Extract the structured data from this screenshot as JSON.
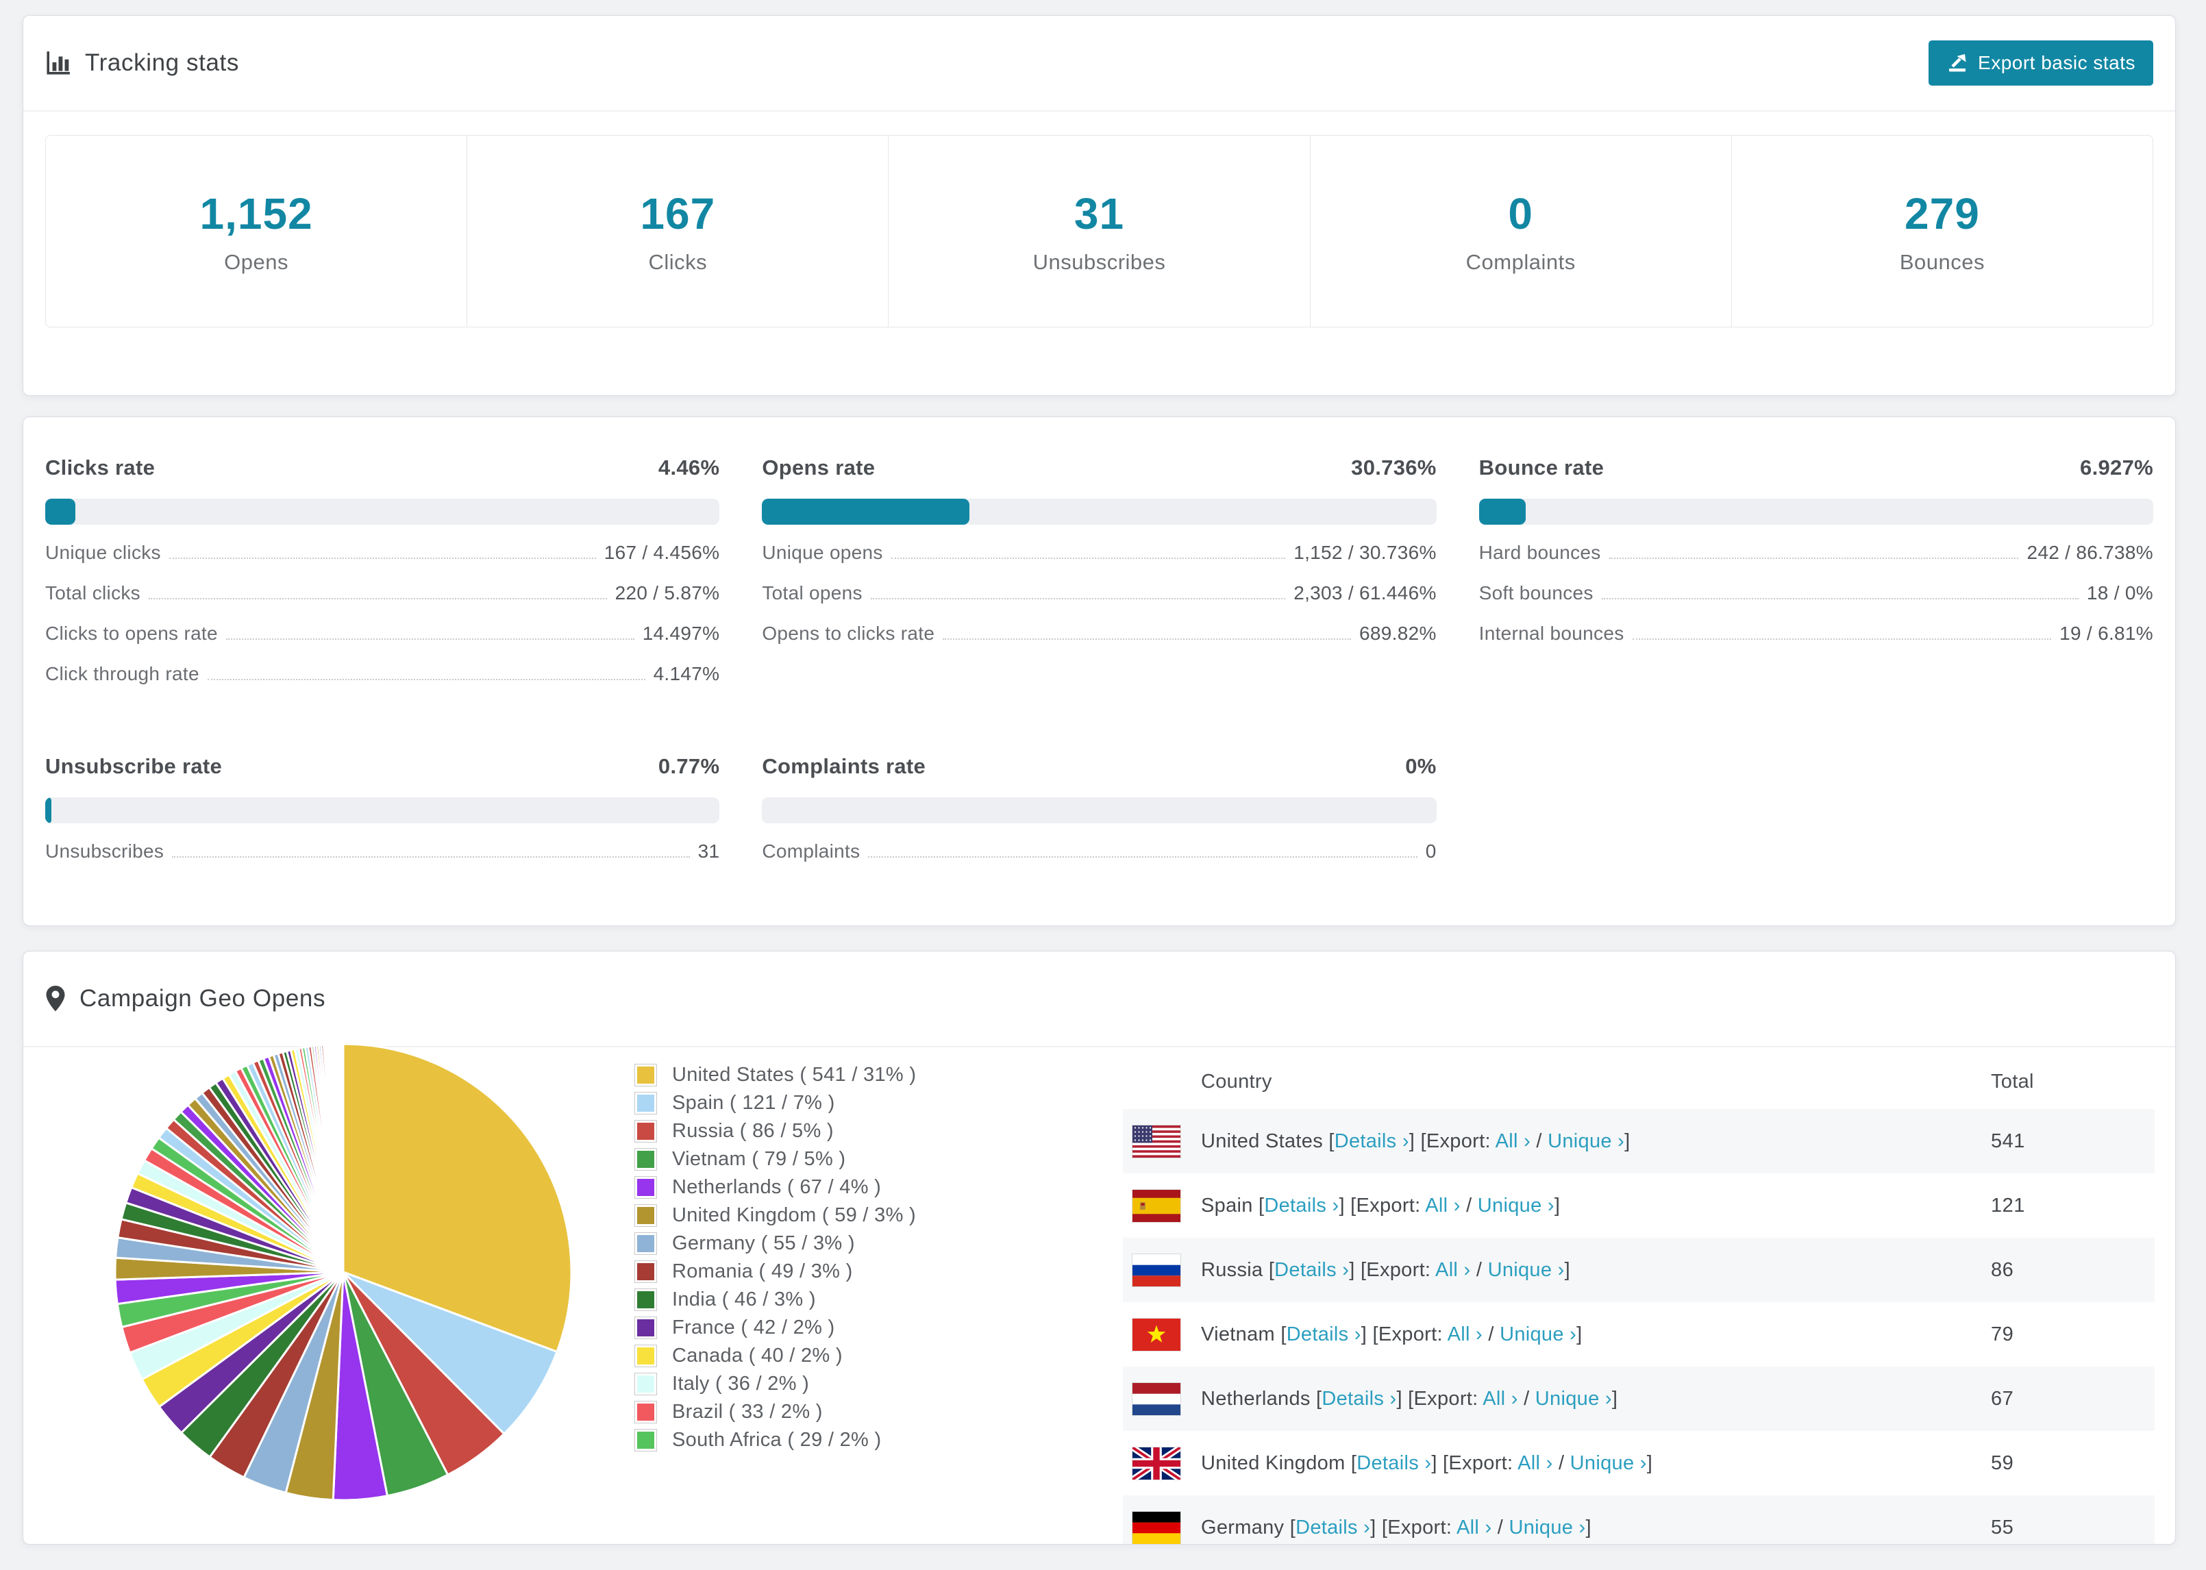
{
  "theme": {
    "accent_color": "#1287a3",
    "link_color": "#2b9ec0",
    "page_background": "#f1f2f4"
  },
  "tracking_card": {
    "title": "Tracking stats",
    "title_icon": "bar-chart-icon",
    "export_button": {
      "label": "Export basic stats",
      "icon": "export-icon"
    },
    "summary": [
      {
        "value": "1,152",
        "label": "Opens"
      },
      {
        "value": "167",
        "label": "Clicks"
      },
      {
        "value": "31",
        "label": "Unsubscribes"
      },
      {
        "value": "0",
        "label": "Complaints"
      },
      {
        "value": "279",
        "label": "Bounces"
      }
    ]
  },
  "rates_card": {
    "blocks": [
      {
        "id": "clicks",
        "title": "Clicks rate",
        "value": "4.46%",
        "percent": 4.46,
        "rows": [
          {
            "label": "Unique clicks",
            "value": "167 / 4.456%"
          },
          {
            "label": "Total clicks",
            "value": "220 / 5.87%"
          },
          {
            "label": "Clicks to opens rate",
            "value": "14.497%"
          },
          {
            "label": "Click through rate",
            "value": "4.147%"
          }
        ]
      },
      {
        "id": "opens",
        "title": "Opens rate",
        "value": "30.736%",
        "percent": 30.736,
        "rows": [
          {
            "label": "Unique opens",
            "value": "1,152 / 30.736%"
          },
          {
            "label": "Total opens",
            "value": "2,303 / 61.446%"
          },
          {
            "label": "Opens to clicks rate",
            "value": "689.82%"
          }
        ]
      },
      {
        "id": "bounce",
        "title": "Bounce rate",
        "value": "6.927%",
        "percent": 6.927,
        "rows": [
          {
            "label": "Hard bounces",
            "value": "242 / 86.738%"
          },
          {
            "label": "Soft bounces",
            "value": "18 / 0%"
          },
          {
            "label": "Internal bounces",
            "value": "19 / 6.81%"
          }
        ]
      },
      {
        "id": "unsubscribe",
        "title": "Unsubscribe rate",
        "value": "0.77%",
        "percent": 0.77,
        "rows": [
          {
            "label": "Unsubscribes",
            "value": "31"
          }
        ]
      },
      {
        "id": "complaints",
        "title": "Complaints rate",
        "value": "0%",
        "percent": 0,
        "rows": [
          {
            "label": "Complaints",
            "value": "0"
          }
        ]
      }
    ]
  },
  "geo_card": {
    "title": "Campaign Geo Opens",
    "title_icon": "map-pin-icon",
    "table": {
      "headers": [
        "Country",
        "Total"
      ],
      "link_labels": {
        "details": "Details ›",
        "all": "All ›",
        "unique": "Unique ›",
        "details_prefix": "[",
        "details_suffix": "] ",
        "export_prefix": "[Export: ",
        "separator": " / ",
        "export_suffix": "]"
      },
      "rows": [
        {
          "country": "United States",
          "flag": "us",
          "total": "541"
        },
        {
          "country": "Spain",
          "flag": "es",
          "total": "121"
        },
        {
          "country": "Russia",
          "flag": "ru",
          "total": "86"
        },
        {
          "country": "Vietnam",
          "flag": "vn",
          "total": "79"
        },
        {
          "country": "Netherlands",
          "flag": "nl",
          "total": "67"
        },
        {
          "country": "United Kingdom",
          "flag": "gb",
          "total": "59"
        },
        {
          "country": "Germany",
          "flag": "de",
          "total": "55"
        }
      ]
    }
  },
  "chart_data": {
    "type": "pie",
    "title": "Campaign Geo Opens",
    "legend_position": "right",
    "start_angle_deg": -90,
    "direction": "clockwise",
    "slices": [
      {
        "label": "United States",
        "value": 541,
        "percent": "31%",
        "color": "#e8c23e"
      },
      {
        "label": "Spain",
        "value": 121,
        "percent": "7%",
        "color": "#abd7f5"
      },
      {
        "label": "Russia",
        "value": 86,
        "percent": "5%",
        "color": "#c94a43"
      },
      {
        "label": "Vietnam",
        "value": 79,
        "percent": "5%",
        "color": "#41a048"
      },
      {
        "label": "Netherlands",
        "value": 67,
        "percent": "4%",
        "color": "#9634ee"
      },
      {
        "label": "United Kingdom",
        "value": 59,
        "percent": "3%",
        "color": "#b3952f"
      },
      {
        "label": "Germany",
        "value": 55,
        "percent": "3%",
        "color": "#8fb3d6"
      },
      {
        "label": "Romania",
        "value": 49,
        "percent": "3%",
        "color": "#a63c34"
      },
      {
        "label": "India",
        "value": 46,
        "percent": "3%",
        "color": "#2f7d33"
      },
      {
        "label": "France",
        "value": 42,
        "percent": "2%",
        "color": "#6a2ea0"
      },
      {
        "label": "Canada",
        "value": 40,
        "percent": "2%",
        "color": "#f8e13d"
      },
      {
        "label": "Italy",
        "value": 36,
        "percent": "2%",
        "color": "#d8fdf8"
      },
      {
        "label": "Brazil",
        "value": 33,
        "percent": "2%",
        "color": "#f2595f"
      },
      {
        "label": "South Africa",
        "value": 29,
        "percent": "2%",
        "color": "#56c45d"
      }
    ],
    "unlabeled_small_slices": {
      "note": "estimated from pixels - many unlabeled thin slices fan out to 12 o'clock",
      "values": [
        30,
        27,
        25,
        23,
        21,
        20,
        19,
        18,
        17,
        16,
        15,
        14,
        13,
        12,
        12,
        11,
        11,
        10,
        10,
        9,
        9,
        8,
        8,
        8,
        7,
        7,
        7,
        6,
        6,
        6,
        5,
        5,
        5,
        5,
        4,
        4,
        4,
        4,
        3,
        3,
        3,
        3,
        3,
        2.5,
        2.5,
        2,
        2,
        2,
        2,
        1.5,
        1.5,
        1.5,
        1,
        1,
        1,
        1,
        0.8,
        0.8,
        0.6,
        0.5
      ],
      "palette": [
        "#abd7f5",
        "#c94a43",
        "#41a048",
        "#9634ee",
        "#b3952f",
        "#8fb3d6",
        "#a63c34",
        "#2f7d33",
        "#6a2ea0",
        "#f8e13d",
        "#d8fdf8",
        "#f2595f",
        "#56c45d"
      ],
      "palette_start_index": 3
    }
  }
}
